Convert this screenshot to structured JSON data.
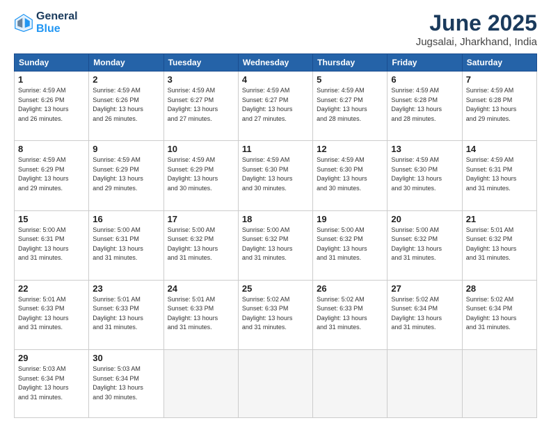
{
  "header": {
    "logo_line1": "General",
    "logo_line2": "Blue",
    "title": "June 2025",
    "subtitle": "Jugsalai, Jharkhand, India"
  },
  "weekdays": [
    "Sunday",
    "Monday",
    "Tuesday",
    "Wednesday",
    "Thursday",
    "Friday",
    "Saturday"
  ],
  "weeks": [
    [
      {
        "day": "1",
        "info": "Sunrise: 4:59 AM\nSunset: 6:26 PM\nDaylight: 13 hours\nand 26 minutes."
      },
      {
        "day": "2",
        "info": "Sunrise: 4:59 AM\nSunset: 6:26 PM\nDaylight: 13 hours\nand 26 minutes."
      },
      {
        "day": "3",
        "info": "Sunrise: 4:59 AM\nSunset: 6:27 PM\nDaylight: 13 hours\nand 27 minutes."
      },
      {
        "day": "4",
        "info": "Sunrise: 4:59 AM\nSunset: 6:27 PM\nDaylight: 13 hours\nand 27 minutes."
      },
      {
        "day": "5",
        "info": "Sunrise: 4:59 AM\nSunset: 6:27 PM\nDaylight: 13 hours\nand 28 minutes."
      },
      {
        "day": "6",
        "info": "Sunrise: 4:59 AM\nSunset: 6:28 PM\nDaylight: 13 hours\nand 28 minutes."
      },
      {
        "day": "7",
        "info": "Sunrise: 4:59 AM\nSunset: 6:28 PM\nDaylight: 13 hours\nand 29 minutes."
      }
    ],
    [
      {
        "day": "8",
        "info": "Sunrise: 4:59 AM\nSunset: 6:29 PM\nDaylight: 13 hours\nand 29 minutes."
      },
      {
        "day": "9",
        "info": "Sunrise: 4:59 AM\nSunset: 6:29 PM\nDaylight: 13 hours\nand 29 minutes."
      },
      {
        "day": "10",
        "info": "Sunrise: 4:59 AM\nSunset: 6:29 PM\nDaylight: 13 hours\nand 30 minutes."
      },
      {
        "day": "11",
        "info": "Sunrise: 4:59 AM\nSunset: 6:30 PM\nDaylight: 13 hours\nand 30 minutes."
      },
      {
        "day": "12",
        "info": "Sunrise: 4:59 AM\nSunset: 6:30 PM\nDaylight: 13 hours\nand 30 minutes."
      },
      {
        "day": "13",
        "info": "Sunrise: 4:59 AM\nSunset: 6:30 PM\nDaylight: 13 hours\nand 30 minutes."
      },
      {
        "day": "14",
        "info": "Sunrise: 4:59 AM\nSunset: 6:31 PM\nDaylight: 13 hours\nand 31 minutes."
      }
    ],
    [
      {
        "day": "15",
        "info": "Sunrise: 5:00 AM\nSunset: 6:31 PM\nDaylight: 13 hours\nand 31 minutes."
      },
      {
        "day": "16",
        "info": "Sunrise: 5:00 AM\nSunset: 6:31 PM\nDaylight: 13 hours\nand 31 minutes."
      },
      {
        "day": "17",
        "info": "Sunrise: 5:00 AM\nSunset: 6:32 PM\nDaylight: 13 hours\nand 31 minutes."
      },
      {
        "day": "18",
        "info": "Sunrise: 5:00 AM\nSunset: 6:32 PM\nDaylight: 13 hours\nand 31 minutes."
      },
      {
        "day": "19",
        "info": "Sunrise: 5:00 AM\nSunset: 6:32 PM\nDaylight: 13 hours\nand 31 minutes."
      },
      {
        "day": "20",
        "info": "Sunrise: 5:00 AM\nSunset: 6:32 PM\nDaylight: 13 hours\nand 31 minutes."
      },
      {
        "day": "21",
        "info": "Sunrise: 5:01 AM\nSunset: 6:32 PM\nDaylight: 13 hours\nand 31 minutes."
      }
    ],
    [
      {
        "day": "22",
        "info": "Sunrise: 5:01 AM\nSunset: 6:33 PM\nDaylight: 13 hours\nand 31 minutes."
      },
      {
        "day": "23",
        "info": "Sunrise: 5:01 AM\nSunset: 6:33 PM\nDaylight: 13 hours\nand 31 minutes."
      },
      {
        "day": "24",
        "info": "Sunrise: 5:01 AM\nSunset: 6:33 PM\nDaylight: 13 hours\nand 31 minutes."
      },
      {
        "day": "25",
        "info": "Sunrise: 5:02 AM\nSunset: 6:33 PM\nDaylight: 13 hours\nand 31 minutes."
      },
      {
        "day": "26",
        "info": "Sunrise: 5:02 AM\nSunset: 6:33 PM\nDaylight: 13 hours\nand 31 minutes."
      },
      {
        "day": "27",
        "info": "Sunrise: 5:02 AM\nSunset: 6:34 PM\nDaylight: 13 hours\nand 31 minutes."
      },
      {
        "day": "28",
        "info": "Sunrise: 5:02 AM\nSunset: 6:34 PM\nDaylight: 13 hours\nand 31 minutes."
      }
    ],
    [
      {
        "day": "29",
        "info": "Sunrise: 5:03 AM\nSunset: 6:34 PM\nDaylight: 13 hours\nand 31 minutes."
      },
      {
        "day": "30",
        "info": "Sunrise: 5:03 AM\nSunset: 6:34 PM\nDaylight: 13 hours\nand 30 minutes."
      },
      null,
      null,
      null,
      null,
      null
    ]
  ]
}
